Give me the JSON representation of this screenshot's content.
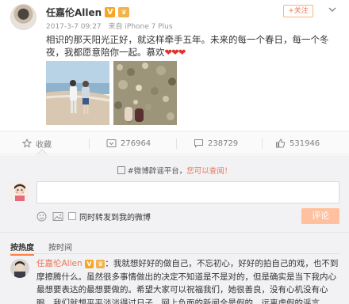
{
  "post": {
    "author": "任嘉伦Allen",
    "timestamp": "2017-3-7 09:27",
    "source": "来自 iPhone 7 Plus",
    "follow_label": "+关注",
    "text": "相识的那天阳光正好，就这样牵手五年。未来的每一个春日，每一个冬夜，我都愿意陪你一起。慕欢",
    "hearts": "❤❤❤"
  },
  "actions": {
    "favorite": "收藏",
    "repost_count": "276964",
    "comment_count": "238729",
    "like_count": "531946"
  },
  "comment_box": {
    "notice_icon": "info-icon",
    "notice_prefix": "#微博辟谣平台，",
    "notice_link": "您可以查阅！",
    "also_repost_label": "同时转发到我的微博",
    "submit_label": "评论"
  },
  "sort_tabs": {
    "hot": "按热度",
    "time": "按时间"
  },
  "top_reply": {
    "author": "任嘉伦Allen",
    "text": "：我就想好好的做自己，不忘初心，好好的拍自己的戏，也不到摩擦腾什么。虽然很多事情做出的决定不知道是不是对的，但是确实是当下我内心最想要表达的最想要做的。希望大家可以祝福我们，她很善良，没有心机没有心眼，我们就想平平淡淡得过日子，网上负面的新闻全是假的，远离虚假的谣言。"
  },
  "colors": {
    "accent": "#eb7350",
    "heart": "#e0342b",
    "submit_bg": "#ffc09f"
  }
}
